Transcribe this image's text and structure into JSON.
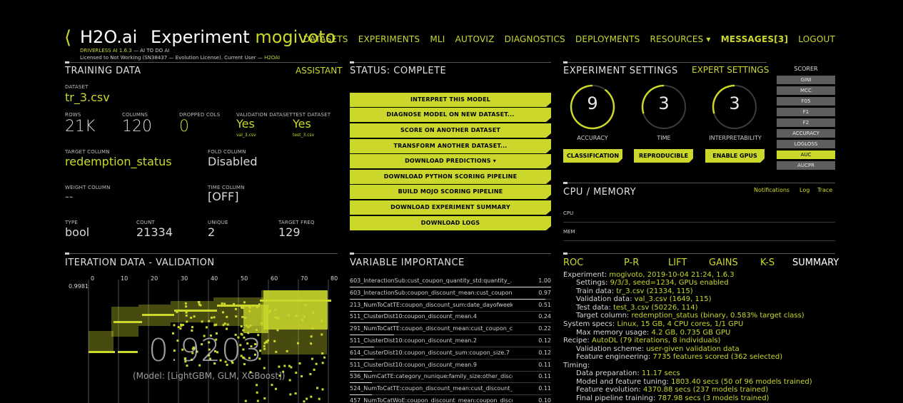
{
  "header": {
    "back_glyph": "⟨",
    "brand": "H2O.ai",
    "experiment_label": "Experiment",
    "experiment_name": "mogivoto",
    "sub1": "DRIVERLESS AI 1.6.3",
    "sub1b": " — AI TO DO AI",
    "sub2": "Licensed to Not Working (SN38437 — Evolution License). Current User —",
    "user": "H2OAI"
  },
  "nav": {
    "datasets": "DATASETS",
    "experiments": "EXPERIMENTS",
    "mli": "MLI",
    "autoviz": "AUTOVIZ",
    "diagnostics": "DIAGNOSTICS",
    "deployments": "DEPLOYMENTS",
    "resources": "RESOURCES ▾",
    "messages": "MESSAGES[3]",
    "logout": "LOGOUT"
  },
  "training": {
    "title": "TRAINING DATA",
    "assistant": "ASSISTANT",
    "dataset_label": "DATASET",
    "dataset": "tr_3.csv",
    "rows_label": "ROWS",
    "rows": "21K",
    "columns_label": "COLUMNS",
    "columns": "120",
    "dropped_label": "DROPPED COLS",
    "dropped": "0",
    "validation_label": "VALIDATION DATASET",
    "validation": "Yes",
    "validation_file": "val_3.csv",
    "test_label": "TEST DATASET",
    "test": "Yes",
    "test_file": "test_3.csv",
    "target_label": "TARGET COLUMN",
    "target": "redemption_status",
    "fold_label": "FOLD COLUMN",
    "fold": "Disabled",
    "weight_label": "WEIGHT COLUMN",
    "weight": "--",
    "time_label": "TIME COLUMN",
    "time": "[OFF]",
    "type_label": "TYPE",
    "type": "bool",
    "count_label": "COUNT",
    "count": "21334",
    "unique_label": "UNIQUE",
    "unique": "2",
    "freq_label": "TARGET FREQ",
    "freq": "129"
  },
  "status": {
    "title": "STATUS: COMPLETE",
    "buttons": [
      "INTERPRET THIS MODEL",
      "DIAGNOSE MODEL ON NEW DATASET...",
      "SCORE ON ANOTHER DATASET",
      "TRANSFORM ANOTHER DATASET...",
      "DOWNLOAD PREDICTIONS ▾",
      "DOWNLOAD PYTHON SCORING PIPELINE",
      "BUILD MOJO SCORING PIPELINE",
      "DOWNLOAD EXPERIMENT SUMMARY",
      "DOWNLOAD LOGS"
    ]
  },
  "settings": {
    "title": "EXPERIMENT SETTINGS",
    "expert": "EXPERT SETTINGS",
    "accuracy": "9",
    "accuracy_label": "ACCURACY",
    "accuracy_level": 0.9,
    "time": "3",
    "time_label": "TIME",
    "time_level": 0.3,
    "interpretability": "3",
    "interpretability_label": "INTERPRETABILITY",
    "interpretability_level": 0.3,
    "classification": "CLASSIFICATION",
    "reproducible": "REPRODUCIBLE",
    "enable_gpus": "ENABLE GPUS"
  },
  "scorer": {
    "title": "SCORER",
    "items": [
      "GINI",
      "MCC",
      "F05",
      "F1",
      "F2",
      "ACCURACY",
      "LOGLOSS",
      "AUC",
      "AUCPR"
    ],
    "active": "AUC"
  },
  "cpu": {
    "title": "CPU / MEMORY",
    "notifications": "Notifications",
    "log": "Log",
    "trace": "Trace",
    "cpu_label": "CPU",
    "mem_label": "MEM"
  },
  "iteration": {
    "title": "ITERATION DATA - VALIDATION",
    "x_ticks": [
      "0",
      "10",
      "20",
      "30",
      "40",
      "50",
      "60",
      "70",
      "80"
    ],
    "y_tick": "0.9981",
    "score": "0.9203",
    "model": "(Model: [LightGBM, GLM, XGBoost])"
  },
  "varimp": {
    "title": "VARIABLE IMPORTANCE",
    "rows": [
      {
        "name": "603_InteractionSub:cust_coupon_quantity_std:quantity_...",
        "value": "1.00",
        "frac": 1.0
      },
      {
        "name": "603_InteractionSub:coupon_discount_mean:cust_coupon...",
        "value": "0.97",
        "frac": 0.97
      },
      {
        "name": "213_NumToCatTE:coupon_discount_sum:date_dayofweek...",
        "value": "0.51",
        "frac": 0.51
      },
      {
        "name": "511_ClusterDist10:coupon_discount_mean.4",
        "value": "0.24",
        "frac": 0.24
      },
      {
        "name": "291_NumToCatTE:coupon_discount_mean:cust_coupon_co...",
        "value": "0.22",
        "frac": 0.22
      },
      {
        "name": "511_ClusterDist10:coupon_discount_mean.2",
        "value": "0.12",
        "frac": 0.12
      },
      {
        "name": "614_ClusterDist10:coupon_discount_sum:coupon_size.7",
        "value": "0.12",
        "frac": 0.12
      },
      {
        "name": "511_ClusterDist10:coupon_discount_mean.9",
        "value": "0.11",
        "frac": 0.11
      },
      {
        "name": "536_NumCatTE:category_nunique:family_size:other_disco...",
        "value": "0.11",
        "frac": 0.11
      },
      {
        "name": "524_NumToCatTE:coupon_discount_mean:cust_discount_...",
        "value": "0.11",
        "frac": 0.11
      },
      {
        "name": "457_NumToCatWoE:coupon_discount_mean:coupon_disco...",
        "value": "0.10",
        "frac": 0.1
      }
    ]
  },
  "tabs": [
    "ROC",
    "P-R",
    "LIFT",
    "GAINS",
    "K-S",
    "SUMMARY"
  ],
  "summary": {
    "l1a": "Experiment: ",
    "l1b": "mogivoto, 2019-10-04 21:24, 1.6.3",
    "l2a": "Settings: ",
    "l2b": "9/3/3, seed=1234, GPUs enabled",
    "l3a": "Train data: ",
    "l3b": "tr_3.csv (21334, 115)",
    "l4a": "Validation data: ",
    "l4b": "val_3.csv (1649, 115)",
    "l5a": "Test data: ",
    "l5b": "test_3.csv (50226, 114)",
    "l6a": "Target column: ",
    "l6b": "redemption_status (binary, 0.583% target class)",
    "l7a": "System specs: ",
    "l7b": "Linux, 15 GB, 4 CPU cores, 1/1 GPU",
    "l8a": "Max memory usage: ",
    "l8b": "4.2 GB, 0.735 GB GPU",
    "l9a": "Recipe: ",
    "l9b": "AutoDL (79 iterations, 8 individuals)",
    "l10a": "Validation scheme: ",
    "l10b": "user-given validation data",
    "l11a": "Feature engineering: ",
    "l11b": "7735 features scored (362 selected)",
    "l12a": "Timing:",
    "l13a": "Data preparation: ",
    "l13b": "11.17 secs",
    "l14a": "Model and feature tuning: ",
    "l14b": "1803.40 secs (50 of 96 models trained)",
    "l15a": "Feature evolution: ",
    "l15b": "4370.88 secs (237 models trained)",
    "l16a": "Final pipeline training: ",
    "l16b": "787.98 secs (3 models trained)"
  }
}
